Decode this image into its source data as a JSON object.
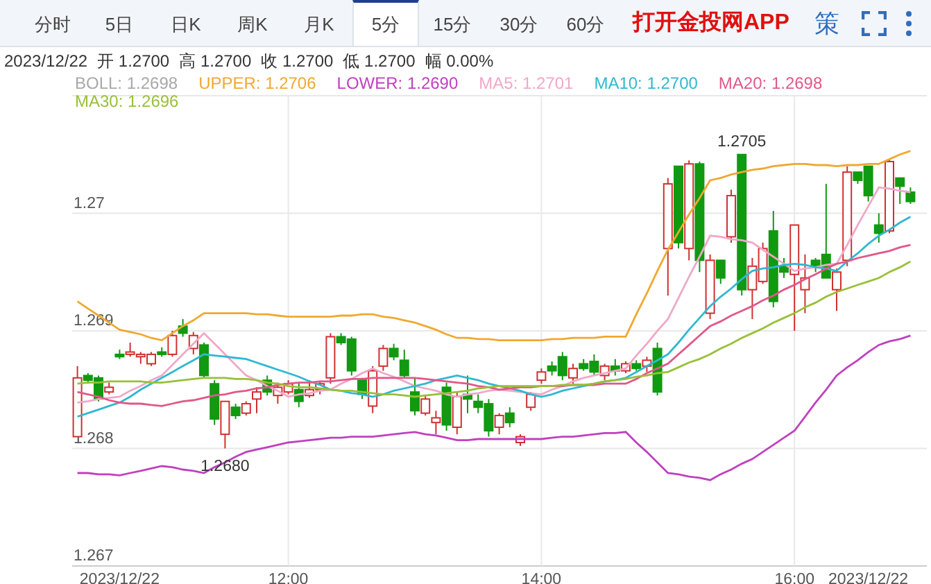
{
  "tabs": [
    {
      "label": "分时",
      "selected": false
    },
    {
      "label": "5日",
      "selected": false
    },
    {
      "label": "日K",
      "selected": false
    },
    {
      "label": "周K",
      "selected": false
    },
    {
      "label": "月K",
      "selected": false
    },
    {
      "label": "5分",
      "selected": true
    },
    {
      "label": "15分",
      "selected": false
    },
    {
      "label": "30分",
      "selected": false
    },
    {
      "label": "60分",
      "selected": false
    }
  ],
  "app_link": "打开金投网APP",
  "strategy_button": "策",
  "quote": {
    "date": "2023/12/22",
    "fields": [
      {
        "label": "开",
        "value": "1.2700"
      },
      {
        "label": "高",
        "value": "1.2700"
      },
      {
        "label": "收",
        "value": "1.2700"
      },
      {
        "label": "低",
        "value": "1.2700"
      },
      {
        "label": "幅",
        "value": "0.00%"
      }
    ]
  },
  "legend": [
    {
      "name": "BOLL",
      "value": ": 1.2698",
      "color": "#a8a8a8"
    },
    {
      "value": ": 1.2706"
    },
    {
      "value": ": 1.2690"
    },
    {
      "value": ": 1.2701"
    },
    {
      "value": ": 1.2700"
    },
    {
      "value": ": 1.2698"
    },
    {
      "value": ": 1.2696"
    }
  ],
  "chart_data": {
    "type": "candlestick",
    "grid": true,
    "categories": [
      null,
      null,
      null,
      null,
      "2023/12/22",
      null,
      null,
      null,
      null,
      null,
      null,
      null,
      null,
      null,
      null,
      null,
      null,
      null,
      null,
      null,
      "12:00",
      null,
      null,
      null,
      null,
      null,
      null,
      null,
      null,
      null,
      null,
      null,
      null,
      null,
      null,
      null,
      null,
      null,
      null,
      null,
      null,
      null,
      null,
      null,
      "14:00",
      null,
      null,
      null,
      null,
      null,
      null,
      null,
      null,
      null,
      null,
      null,
      null,
      null,
      null,
      null,
      null,
      null,
      null,
      null,
      null,
      null,
      null,
      null,
      "16:00",
      null,
      null,
      null,
      null,
      null,
      null,
      "2023/12/22",
      null,
      null,
      null,
      null
    ],
    "ylim": [
      1.267,
      1.271
    ],
    "yticks": [
      {
        "value": 1.267,
        "label": "1.267"
      },
      {
        "value": 1.268,
        "label": "1.268"
      },
      {
        "value": 1.269,
        "label": "1.269"
      },
      {
        "value": 1.27,
        "label": "1.27"
      }
    ],
    "ohlc": [
      [
        1.2681,
        1.2687,
        1.2681,
        1.2686
      ],
      [
        1.26862,
        1.26864,
        1.26855,
        1.26858
      ],
      [
        1.2686,
        1.26862,
        1.2684,
        1.26842
      ],
      [
        1.26848,
        1.26856,
        1.26846,
        1.26852
      ],
      [
        1.2688,
        1.26884,
        1.26876,
        1.26878
      ],
      [
        1.2688,
        1.2689,
        1.26878,
        1.26882
      ],
      [
        1.26878,
        1.26882,
        1.26872,
        1.2688
      ],
      [
        1.26872,
        1.26882,
        1.2687,
        1.2688
      ],
      [
        1.26882,
        1.26886,
        1.26878,
        1.2688
      ],
      [
        1.2688,
        1.269,
        1.26878,
        1.26896
      ],
      [
        1.26904,
        1.2691,
        1.26895,
        1.26898
      ],
      [
        1.26885,
        1.26899,
        1.2688,
        1.26896
      ],
      [
        1.26888,
        1.2689,
        1.2686,
        1.26862
      ],
      [
        1.26855,
        1.26858,
        1.2682,
        1.26825
      ],
      [
        1.26812,
        1.2684,
        1.268,
        1.2684
      ],
      [
        1.26835,
        1.26838,
        1.26825,
        1.26828
      ],
      [
        1.2683,
        1.2684,
        1.26828,
        1.26838
      ],
      [
        1.26842,
        1.26852,
        1.2683,
        1.26848
      ],
      [
        1.26858,
        1.26862,
        1.26845,
        1.26848
      ],
      [
        1.26845,
        1.26856,
        1.26838,
        1.26852
      ],
      [
        1.26848,
        1.26858,
        1.26846,
        1.26855
      ],
      [
        1.2685,
        1.26856,
        1.26835,
        1.2684
      ],
      [
        1.26845,
        1.26858,
        1.26843,
        1.2685
      ],
      [
        1.2685,
        1.26857,
        1.26846,
        1.26855
      ],
      [
        1.2686,
        1.26898,
        1.26855,
        1.26895
      ],
      [
        1.26895,
        1.26898,
        1.26888,
        1.2689
      ],
      [
        1.26893,
        1.26895,
        1.26862,
        1.26866
      ],
      [
        1.26858,
        1.2686,
        1.26842,
        1.26846
      ],
      [
        1.26836,
        1.2687,
        1.2683,
        1.26866
      ],
      [
        1.2687,
        1.26888,
        1.26866,
        1.26885
      ],
      [
        1.26885,
        1.26889,
        1.26875,
        1.26878
      ],
      [
        1.26875,
        1.26884,
        1.2686,
        1.26862
      ],
      [
        1.26848,
        1.2686,
        1.26828,
        1.26832
      ],
      [
        1.2683,
        1.26845,
        1.26828,
        1.26842
      ],
      [
        1.26822,
        1.26832,
        1.26812,
        1.26826
      ],
      [
        1.26852,
        1.26856,
        1.26815,
        1.2682
      ],
      [
        1.26818,
        1.26848,
        1.26812,
        1.26844
      ],
      [
        1.26846,
        1.26862,
        1.2683,
        1.26842
      ],
      [
        1.2684,
        1.26846,
        1.2683,
        1.26835
      ],
      [
        1.26838,
        1.26842,
        1.2681,
        1.26815
      ],
      [
        1.26818,
        1.2683,
        1.26812,
        1.26828
      ],
      [
        1.2683,
        1.26835,
        1.26818,
        1.26822
      ],
      [
        1.26805,
        1.26812,
        1.26802,
        1.2681
      ],
      [
        1.26835,
        1.26848,
        1.26832,
        1.26846
      ],
      [
        1.26858,
        1.26868,
        1.26855,
        1.26865
      ],
      [
        1.2687,
        1.26874,
        1.26862,
        1.26866
      ],
      [
        1.26878,
        1.26882,
        1.26858,
        1.26862
      ],
      [
        1.2686,
        1.26872,
        1.26855,
        1.26868
      ],
      [
        1.26872,
        1.26876,
        1.26866,
        1.26868
      ],
      [
        1.26874,
        1.2688,
        1.26862,
        1.26865
      ],
      [
        1.26862,
        1.26872,
        1.26858,
        1.2687
      ],
      [
        1.2687,
        1.26876,
        1.26862,
        1.26866
      ],
      [
        1.26866,
        1.26874,
        1.26864,
        1.26872
      ],
      [
        1.26872,
        1.26875,
        1.26866,
        1.26868
      ],
      [
        1.2687,
        1.26878,
        1.26865,
        1.26875
      ],
      [
        1.26885,
        1.2689,
        1.26845,
        1.26848
      ],
      [
        1.2697,
        1.2703,
        1.2693,
        1.27025
      ],
      [
        1.2704,
        1.2704,
        1.2697,
        1.26975
      ],
      [
        1.2697,
        1.27045,
        1.2696,
        1.27042
      ],
      [
        1.27042,
        1.27044,
        1.2695,
        1.2696
      ],
      [
        1.26915,
        1.26965,
        1.2691,
        1.2696
      ],
      [
        1.2696,
        1.2696,
        1.2694,
        1.26945
      ],
      [
        1.2698,
        1.2702,
        1.26975,
        1.27015
      ],
      [
        1.2705,
        1.2705,
        1.2693,
        1.26935
      ],
      [
        1.26935,
        1.26962,
        1.2691,
        1.26955
      ],
      [
        1.26942,
        1.26975,
        1.2694,
        1.2697
      ],
      [
        1.26985,
        1.27002,
        1.2692,
        1.26925
      ],
      [
        1.26955,
        1.26962,
        1.26945,
        1.2695
      ],
      [
        1.26948,
        1.2699,
        1.269,
        1.2699
      ],
      [
        1.26935,
        1.26965,
        1.26915,
        1.26945
      ],
      [
        1.2696,
        1.26962,
        1.2695,
        1.26955
      ],
      [
        1.26965,
        1.27025,
        1.26945,
        1.26945
      ],
      [
        1.26935,
        1.26953,
        1.26917,
        1.2695
      ],
      [
        1.2696,
        1.2704,
        1.26955,
        1.27035
      ],
      [
        1.27035,
        1.27035,
        1.27025,
        1.27028
      ],
      [
        1.2704,
        1.2704,
        1.2701,
        1.27015
      ],
      [
        1.2699,
        1.27,
        1.26975,
        1.26983
      ],
      [
        1.26985,
        1.27046,
        1.26983,
        1.27044
      ],
      [
        1.2703,
        1.2703,
        1.27008,
        1.27023
      ],
      [
        1.27018,
        1.27022,
        1.27008,
        1.2701
      ]
    ],
    "series": [
      {
        "name": "UPPER",
        "type": "line",
        "color": "#f0a830",
        "values": [
          1.26925,
          1.26919,
          1.26913,
          1.26907,
          1.26901,
          1.26899,
          1.26897,
          1.26894,
          1.26892,
          1.26898,
          1.26904,
          1.26909,
          1.26915,
          1.26915,
          1.26915,
          1.26915,
          1.26915,
          1.26914,
          1.26914,
          1.26913,
          1.26912,
          1.26912,
          1.26912,
          1.26912,
          1.26912,
          1.26913,
          1.26913,
          1.26914,
          1.26914,
          1.26912,
          1.26911,
          1.26909,
          1.26907,
          1.26904,
          1.26901,
          1.26897,
          1.26894,
          1.26894,
          1.26893,
          1.26893,
          1.26892,
          1.26892,
          1.26892,
          1.26892,
          1.26892,
          1.26893,
          1.26893,
          1.26894,
          1.26894,
          1.26894,
          1.26895,
          1.26895,
          1.26895,
          1.26914,
          1.26932,
          1.26951,
          1.26969,
          1.26984,
          1.26999,
          1.27013,
          1.27028,
          1.2703,
          1.27033,
          1.27035,
          1.27037,
          1.27038,
          1.2704,
          1.27041,
          1.27042,
          1.27042,
          1.27041,
          1.27041,
          1.2704,
          1.27041,
          1.27041,
          1.27042,
          1.27042,
          1.27046,
          1.2705,
          1.27053
        ]
      },
      {
        "name": "LOWER",
        "type": "line",
        "color": "#c040c0",
        "values": [
          1.26779,
          1.26779,
          1.26778,
          1.26778,
          1.26777,
          1.26779,
          1.26781,
          1.26783,
          1.26785,
          1.26784,
          1.26782,
          1.26781,
          1.26779,
          1.26784,
          1.26788,
          1.26793,
          1.26797,
          1.26799,
          1.26801,
          1.26803,
          1.26805,
          1.26806,
          1.26807,
          1.26808,
          1.26809,
          1.26809,
          1.2681,
          1.2681,
          1.2681,
          1.26811,
          1.26812,
          1.26813,
          1.26814,
          1.26812,
          1.26811,
          1.26809,
          1.26807,
          1.26807,
          1.26808,
          1.26808,
          1.26808,
          1.26808,
          1.26808,
          1.26808,
          1.26808,
          1.26809,
          1.2681,
          1.2681,
          1.26811,
          1.26812,
          1.26813,
          1.26813,
          1.26814,
          1.26805,
          1.26797,
          1.26788,
          1.26779,
          1.26778,
          1.26776,
          1.26775,
          1.26773,
          1.26778,
          1.26782,
          1.26787,
          1.26791,
          1.26797,
          1.26803,
          1.26809,
          1.26815,
          1.26827,
          1.26839,
          1.2685,
          1.26862,
          1.26869,
          1.26875,
          1.26882,
          1.26888,
          1.26891,
          1.26893,
          1.26896
        ]
      },
      {
        "name": "MA5",
        "type": "line",
        "color": "#f0a8c8",
        "values": [
          1.26839,
          1.2684,
          1.26842,
          1.26843,
          1.26844,
          1.26849,
          1.26853,
          1.26858,
          1.26862,
          1.26871,
          1.2688,
          1.26889,
          1.26898,
          1.26889,
          1.2688,
          1.26871,
          1.26862,
          1.26858,
          1.26853,
          1.26849,
          1.26844,
          1.26846,
          1.26847,
          1.26849,
          1.2685,
          1.26855,
          1.26859,
          1.26864,
          1.26868,
          1.26864,
          1.26861,
          1.26857,
          1.26853,
          1.26851,
          1.26849,
          1.26846,
          1.26844,
          1.26846,
          1.26847,
          1.26849,
          1.2685,
          1.26849,
          1.26848,
          1.26847,
          1.26846,
          1.2685,
          1.26853,
          1.26857,
          1.2686,
          1.26862,
          1.26864,
          1.26866,
          1.26868,
          1.26879,
          1.26889,
          1.269,
          1.2691,
          1.26928,
          1.26946,
          1.26963,
          1.26981,
          1.2698,
          1.26978,
          1.26977,
          1.26975,
          1.26969,
          1.26963,
          1.26957,
          1.26951,
          1.26953,
          1.26954,
          1.26956,
          1.26957,
          1.26973,
          1.2699,
          1.27006,
          1.27022,
          1.27021,
          1.27019,
          1.27018
        ]
      },
      {
        "name": "MA10",
        "type": "line",
        "color": "#30b8d0",
        "values": [
          1.26827,
          1.2683,
          1.26833,
          1.26836,
          1.26839,
          1.26844,
          1.2685,
          1.26855,
          1.2686,
          1.26865,
          1.2687,
          1.26875,
          1.2688,
          1.26879,
          1.26878,
          1.26877,
          1.26876,
          1.26873,
          1.2687,
          1.26867,
          1.26864,
          1.26861,
          1.26857,
          1.26854,
          1.2685,
          1.26849,
          1.26847,
          1.26846,
          1.26844,
          1.26846,
          1.26849,
          1.26851,
          1.26853,
          1.26855,
          1.26858,
          1.2686,
          1.26862,
          1.2686,
          1.26858,
          1.26855,
          1.26853,
          1.26851,
          1.26849,
          1.26846,
          1.26844,
          1.26846,
          1.26849,
          1.26851,
          1.26853,
          1.26855,
          1.26857,
          1.26858,
          1.2686,
          1.26865,
          1.2687,
          1.26875,
          1.2688,
          1.2689,
          1.26901,
          1.26911,
          1.26921,
          1.26929,
          1.26936,
          1.26944,
          1.26951,
          1.26953,
          1.26954,
          1.26956,
          1.26957,
          1.26956,
          1.26954,
          1.26953,
          1.26951,
          1.26959,
          1.26966,
          1.26974,
          1.26981,
          1.26986,
          1.26992,
          1.26997
        ]
      },
      {
        "name": "MA20",
        "type": "line",
        "color": "#e05888",
        "values": [
          1.26848,
          1.26846,
          1.26844,
          1.26841,
          1.26839,
          1.26838,
          1.26838,
          1.26837,
          1.26836,
          1.26838,
          1.2684,
          1.26841,
          1.26843,
          1.26845,
          1.26846,
          1.26848,
          1.26849,
          1.26851,
          1.26852,
          1.26854,
          1.26855,
          1.26856,
          1.26856,
          1.26857,
          1.26857,
          1.26858,
          1.26859,
          1.26859,
          1.2686,
          1.2686,
          1.2686,
          1.2686,
          1.2686,
          1.26859,
          1.26858,
          1.26857,
          1.26856,
          1.26855,
          1.26853,
          1.26852,
          1.2685,
          1.26851,
          1.26852,
          1.26852,
          1.26853,
          1.26853,
          1.26853,
          1.26854,
          1.26854,
          1.26854,
          1.26855,
          1.26855,
          1.26855,
          1.26859,
          1.26864,
          1.26868,
          1.26872,
          1.2688,
          1.26888,
          1.26896,
          1.26904,
          1.26908,
          1.26913,
          1.26917,
          1.26921,
          1.26926,
          1.2693,
          1.26935,
          1.26939,
          1.26944,
          1.26948,
          1.26953,
          1.26957,
          1.26959,
          1.26962,
          1.26964,
          1.26966,
          1.26968,
          1.26971,
          1.26973
        ]
      },
      {
        "name": "MA30",
        "type": "line",
        "color": "#98c038",
        "values": [
          1.26855,
          1.26856,
          1.26856,
          1.26857,
          1.26857,
          1.26857,
          1.26857,
          1.26856,
          1.26856,
          1.26857,
          1.26858,
          1.26859,
          1.2686,
          1.2686,
          1.2686,
          1.26859,
          1.26859,
          1.26858,
          1.26856,
          1.26855,
          1.26853,
          1.26852,
          1.26852,
          1.26851,
          1.2685,
          1.26849,
          1.26849,
          1.26848,
          1.26847,
          1.26846,
          1.26846,
          1.26845,
          1.26844,
          1.26845,
          1.26846,
          1.26847,
          1.26848,
          1.26849,
          1.26851,
          1.26852,
          1.26853,
          1.26853,
          1.26853,
          1.26853,
          1.26853,
          1.26853,
          1.26854,
          1.26854,
          1.26854,
          1.26855,
          1.26857,
          1.26858,
          1.26859,
          1.26861,
          1.26862,
          1.26864,
          1.26865,
          1.26869,
          1.26873,
          1.26876,
          1.2688,
          1.26885,
          1.26889,
          1.26894,
          1.26898,
          1.26902,
          1.26907,
          1.26911,
          1.26915,
          1.2692,
          1.26924,
          1.26929,
          1.26933,
          1.26936,
          1.26939,
          1.26942,
          1.26945,
          1.2695,
          1.26954,
          1.26959
        ]
      }
    ],
    "annotations": [
      "1.2680",
      "1.2705"
    ]
  }
}
